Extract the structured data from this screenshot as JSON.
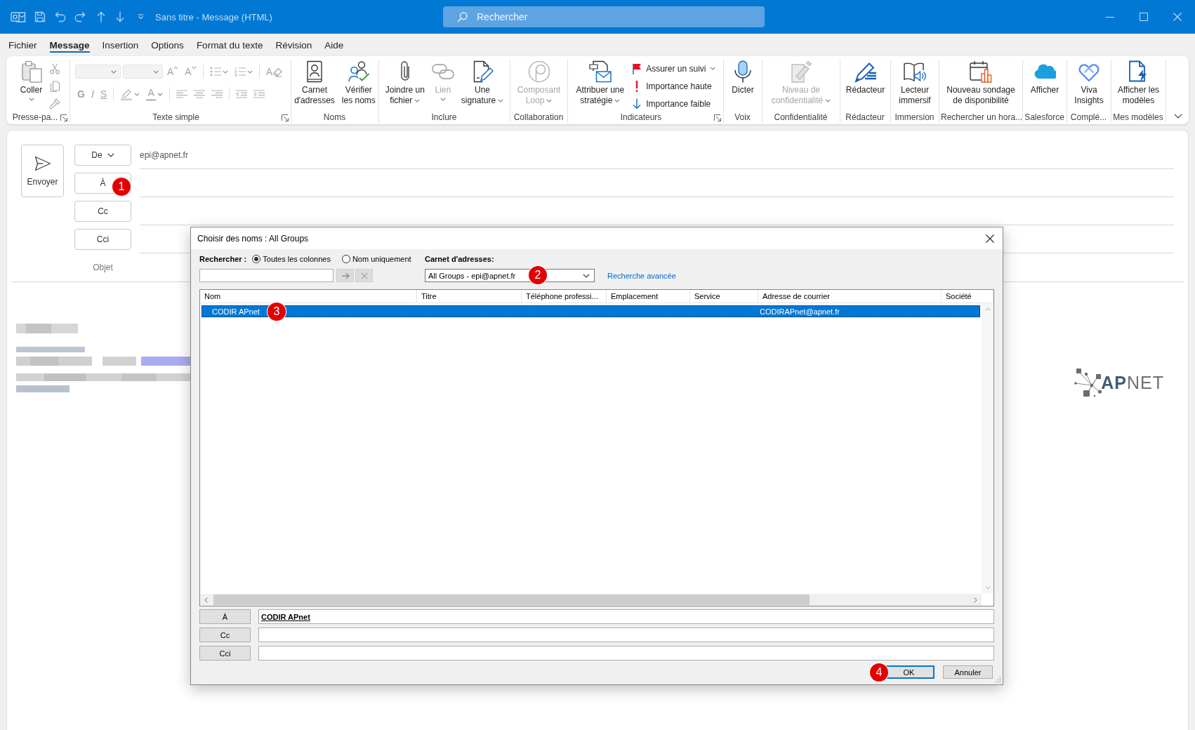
{
  "title_bar": {
    "title": "Sans titre - Message (HTML)",
    "search": {
      "placeholder": "Rechercher"
    }
  },
  "menu_tabs": [
    {
      "label": "Fichier",
      "selected": false
    },
    {
      "label": "Message",
      "selected": true
    },
    {
      "label": "Insertion",
      "selected": false
    },
    {
      "label": "Options",
      "selected": false
    },
    {
      "label": "Format du texte",
      "selected": false
    },
    {
      "label": "Révision",
      "selected": false
    },
    {
      "label": "Aide",
      "selected": false
    }
  ],
  "ribbon": {
    "groups": [
      {
        "label": "Presse-pa...",
        "launcher": true,
        "items": [
          {
            "kind": "large",
            "label": "Coller",
            "caret": true,
            "disabled": false
          },
          {
            "kind": "icon",
            "caret": false,
            "disabled": true
          },
          {
            "kind": "icon",
            "caret": false,
            "disabled": true
          },
          {
            "kind": "icon",
            "caret": false,
            "disabled": true
          }
        ]
      },
      {
        "label": "Texte simple",
        "launcher": true,
        "rows": [
          [
            {
              "kind": "dropdown",
              "disabled": true
            },
            {
              "kind": "dropdown",
              "disabled": true
            },
            {
              "kind": "glyph",
              "glyph": "A",
              "caret": false,
              "disabled": true
            },
            {
              "kind": "glyph",
              "glyph": "A",
              "caret": false,
              "disabled": true
            },
            {
              "kind": "separator"
            },
            {
              "kind": "icon",
              "caret": true,
              "disabled": true
            },
            {
              "kind": "icon",
              "caret": true,
              "disabled": true
            },
            {
              "kind": "separator"
            },
            {
              "kind": "glyph",
              "glyph": "A",
              "caret": false,
              "disabled": true
            }
          ],
          [
            {
              "kind": "glyph",
              "glyph": "G",
              "caret": false,
              "disabled": true
            },
            {
              "kind": "glyph",
              "glyph": "I",
              "caret": false,
              "disabled": true
            },
            {
              "kind": "glyph",
              "glyph": "S",
              "caret": false,
              "disabled": true
            },
            {
              "kind": "separator"
            },
            {
              "kind": "icon",
              "caret": true,
              "disabled": true
            },
            {
              "kind": "glyph",
              "glyph": "A",
              "caret": true,
              "disabled": true
            },
            {
              "kind": "separator"
            },
            {
              "kind": "icon",
              "caret": false,
              "disabled": true
            },
            {
              "kind": "icon",
              "caret": false,
              "disabled": true
            },
            {
              "kind": "icon",
              "caret": false,
              "disabled": true
            },
            {
              "kind": "separator"
            },
            {
              "kind": "icon",
              "caret": false,
              "disabled": true
            },
            {
              "kind": "icon",
              "caret": false,
              "disabled": true
            }
          ]
        ]
      },
      {
        "label": "Noms",
        "launcher": false,
        "items": [
          {
            "kind": "large",
            "label": "Carnet\nd'adresses",
            "caret": false,
            "disabled": false
          },
          {
            "kind": "large",
            "label": "Vérifier\nles noms",
            "caret": false,
            "disabled": false
          }
        ]
      },
      {
        "label": "Inclure",
        "launcher": false,
        "items": [
          {
            "kind": "large",
            "label": "Joindre un\nfichier",
            "caret": true,
            "disabled": false
          },
          {
            "kind": "large",
            "label": "Lien",
            "caret": true,
            "disabled": true
          },
          {
            "kind": "large",
            "label": "Une\nsignature",
            "caret": true,
            "disabled": false
          }
        ]
      },
      {
        "label": "Collaboration",
        "launcher": false,
        "items": [
          {
            "kind": "large",
            "label": "Composant\nLoop",
            "caret": true,
            "disabled": true
          }
        ]
      },
      {
        "label": "Indicateurs",
        "launcher": true,
        "items": [
          {
            "kind": "large",
            "label": "Attribuer une\nstratégie",
            "caret": true,
            "disabled": false
          },
          {
            "kind": "small",
            "label": "Assurer un suivi",
            "caret": true,
            "disabled": false
          },
          {
            "kind": "small",
            "label": "Importance haute",
            "caret": false,
            "disabled": false
          },
          {
            "kind": "small",
            "label": "Importance faible",
            "caret": false,
            "disabled": false
          }
        ]
      },
      {
        "label": "Voix",
        "launcher": false,
        "items": [
          {
            "kind": "large",
            "label": "Dicter",
            "caret": false,
            "disabled": false
          }
        ]
      },
      {
        "label": "Confidentialité",
        "launcher": false,
        "items": [
          {
            "kind": "large",
            "label": "Niveau de\nconfidentialité",
            "caret": true,
            "disabled": true
          }
        ]
      },
      {
        "label": "Rédacteur",
        "launcher": false,
        "items": [
          {
            "kind": "large",
            "label": "Rédacteur",
            "caret": false,
            "disabled": false
          }
        ]
      },
      {
        "label": "Immersion",
        "launcher": false,
        "items": [
          {
            "kind": "large",
            "label": "Lecteur\nimmersif",
            "caret": false,
            "disabled": false
          }
        ]
      },
      {
        "label": "Rechercher un hora...",
        "launcher": false,
        "items": [
          {
            "kind": "large",
            "label": "Nouveau sondage\nde disponibilité",
            "caret": false,
            "disabled": false
          }
        ]
      },
      {
        "label": "Salesforce",
        "launcher": false,
        "items": [
          {
            "kind": "large",
            "label": "Afficher",
            "caret": false,
            "disabled": false
          }
        ]
      },
      {
        "label": "Complé...",
        "launcher": false,
        "items": [
          {
            "kind": "large",
            "label": "Viva\nInsights",
            "caret": false,
            "disabled": false
          }
        ]
      },
      {
        "label": "Mes modèles",
        "launcher": false,
        "items": [
          {
            "kind": "large",
            "label": "Afficher les\nmodèles",
            "caret": false,
            "disabled": false
          }
        ]
      }
    ]
  },
  "compose": {
    "send_label": "Envoyer",
    "recipients": [
      {
        "label": "De",
        "caret": true,
        "value": "epi@apnet.fr"
      },
      {
        "label": "À",
        "caret": false,
        "callout": "1"
      },
      {
        "label": "Cc",
        "caret": false
      },
      {
        "label": "Cci",
        "caret": false
      }
    ],
    "subject_label": "Objet"
  },
  "signature_logo": {
    "text": "**AP**NET"
  },
  "dialog": {
    "title": "Choisir des noms : All Groups",
    "search": {
      "label": "Rechercher :",
      "options": [
        {
          "label": "Toutes les colonnes",
          "selected": true
        },
        {
          "label": "Nom uniquement",
          "selected": false
        }
      ]
    },
    "address_book": {
      "label": "Carnet d'adresses:",
      "value": "All Groups - epi@apnet.fr",
      "callout": "2"
    },
    "advanced_search": "Recherche avancée",
    "table": {
      "columns": [
        "Nom",
        "Titre",
        "Téléphone professi...",
        "Emplacement",
        "Service",
        "Adresse de courrier",
        "Société"
      ],
      "rows": [
        {
          "name": "CODIR APnet",
          "email": "CODIRAPnet@apnet.fr",
          "selected": true,
          "callout": "3"
        }
      ]
    },
    "recipients": [
      {
        "label": "À",
        "value": "CODIR APnet"
      },
      {
        "label": "Cc"
      },
      {
        "label": "Cci"
      }
    ],
    "buttons": [
      {
        "label": "OK",
        "default": true,
        "callout": "4"
      },
      {
        "label": "Annuler",
        "default": false
      }
    ]
  }
}
